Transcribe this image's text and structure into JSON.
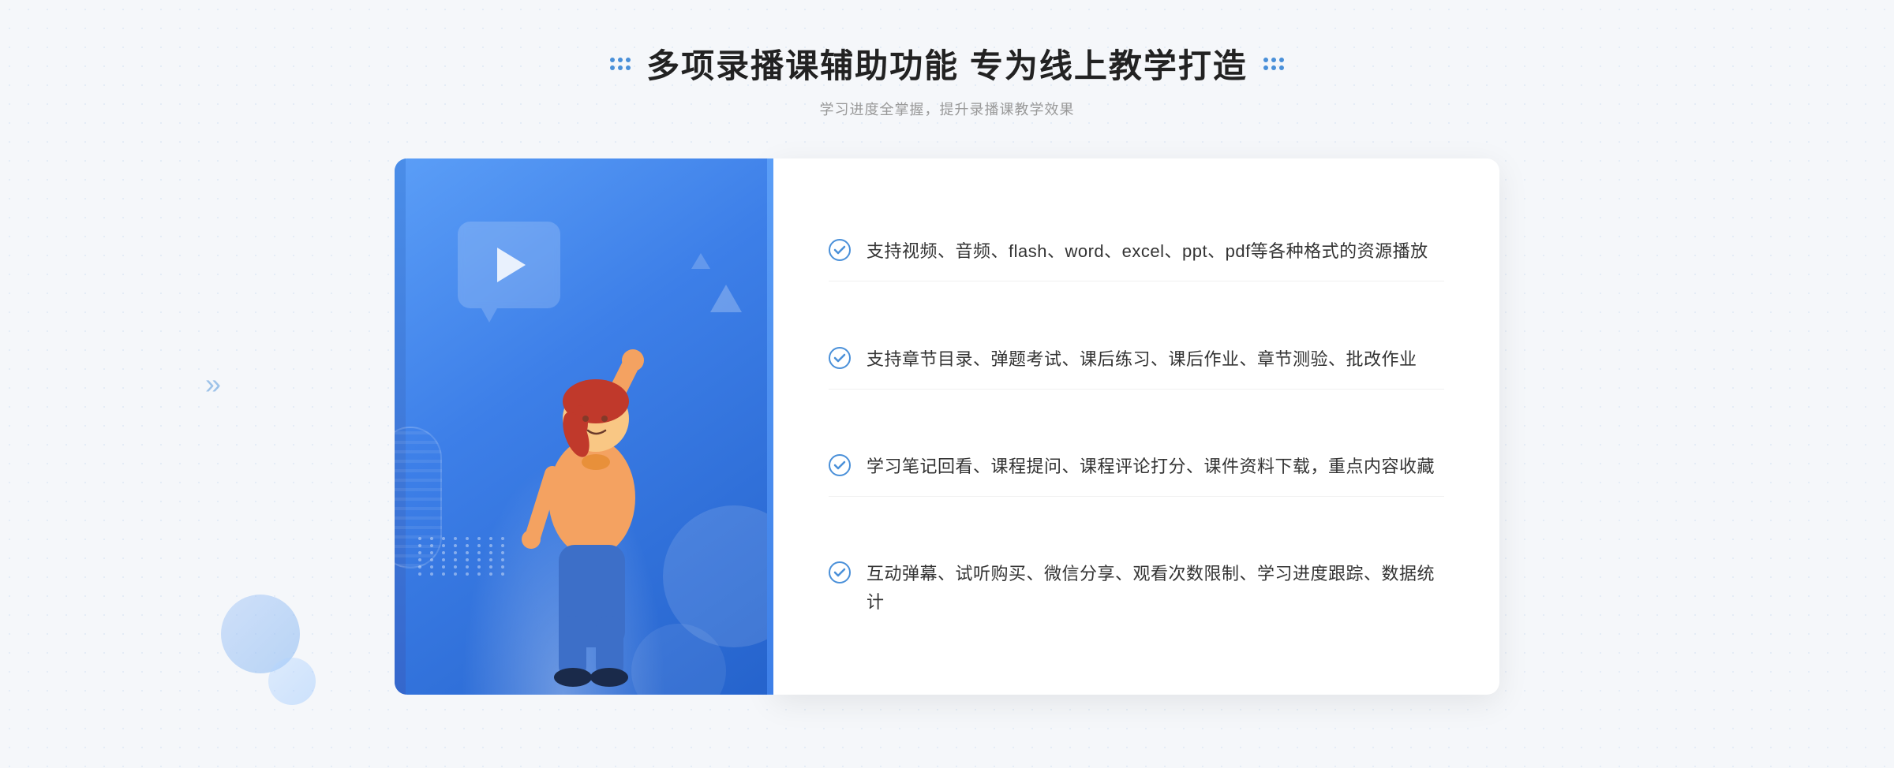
{
  "header": {
    "title": "多项录播课辅助功能 专为线上教学打造",
    "subtitle": "学习进度全掌握，提升录播课教学效果"
  },
  "features": [
    {
      "id": "feature-1",
      "text": "支持视频、音频、flash、word、excel、ppt、pdf等各种格式的资源播放"
    },
    {
      "id": "feature-2",
      "text": "支持章节目录、弹题考试、课后练习、课后作业、章节测验、批改作业"
    },
    {
      "id": "feature-3",
      "text": "学习笔记回看、课程提问、课程评论打分、课件资料下载，重点内容收藏"
    },
    {
      "id": "feature-4",
      "text": "互动弹幕、试听购买、微信分享、观看次数限制、学习进度跟踪、数据统计"
    }
  ],
  "decorators": {
    "left_dots": "⋮⋮",
    "right_dots": "⋮⋮",
    "left_arrows": "«",
    "check_icon_color": "#4a90d9"
  }
}
